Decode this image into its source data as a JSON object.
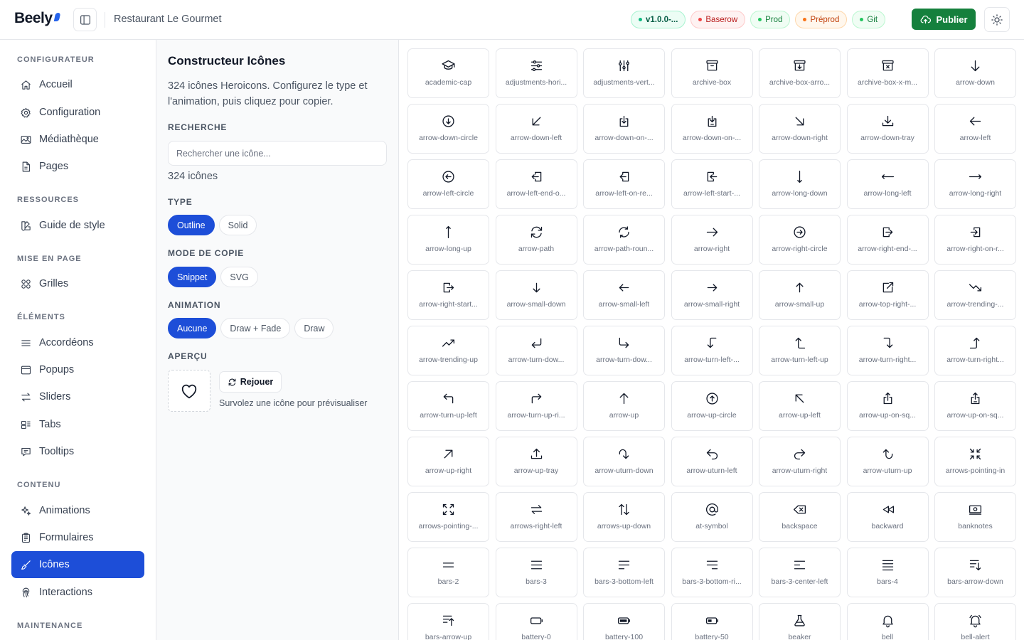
{
  "header": {
    "logo": "Beely",
    "site_name": "Restaurant Le Gourmet",
    "pills": [
      {
        "label": "v1.0.0-...",
        "kind": "version"
      },
      {
        "label": "Baserow",
        "kind": "baserow"
      },
      {
        "label": "Prod",
        "kind": "prod"
      },
      {
        "label": "Préprod",
        "kind": "preprod"
      },
      {
        "label": "Git",
        "kind": "git"
      }
    ],
    "publish_label": "Publier",
    "colors": {
      "accent": "#1d4ed8",
      "publish": "#15803d"
    }
  },
  "sidebar": {
    "sections": [
      {
        "title": "CONFIGURATEUR",
        "items": [
          {
            "label": "Accueil",
            "icon": "home-icon"
          },
          {
            "label": "Configuration",
            "icon": "cog-icon"
          },
          {
            "label": "Médiathèque",
            "icon": "photo-icon"
          },
          {
            "label": "Pages",
            "icon": "document-icon"
          }
        ]
      },
      {
        "title": "RESSOURCES",
        "items": [
          {
            "label": "Guide de style",
            "icon": "swatch-icon"
          }
        ]
      },
      {
        "title": "MISE EN PAGE",
        "items": [
          {
            "label": "Grilles",
            "icon": "squares-icon"
          }
        ]
      },
      {
        "title": "ÉLÉMENTS",
        "items": [
          {
            "label": "Accordéons",
            "icon": "bars-icon"
          },
          {
            "label": "Popups",
            "icon": "window-icon"
          },
          {
            "label": "Sliders",
            "icon": "arrows-right-left-icon"
          },
          {
            "label": "Tabs",
            "icon": "tabs-icon"
          },
          {
            "label": "Tooltips",
            "icon": "chat-icon"
          }
        ]
      },
      {
        "title": "CONTENU",
        "items": [
          {
            "label": "Animations",
            "icon": "sparkles-icon"
          },
          {
            "label": "Formulaires",
            "icon": "clipboard-icon"
          },
          {
            "label": "Icônes",
            "icon": "paint-brush-icon",
            "active": true
          },
          {
            "label": "Interactions",
            "icon": "finger-print-icon"
          }
        ]
      },
      {
        "title": "MAINTENANCE",
        "items": []
      }
    ]
  },
  "config": {
    "title": "Constructeur Icônes",
    "description": "324 icônes Heroicons. Configurez le type et l'animation, puis cliquez pour copier.",
    "search_label": "RECHERCHE",
    "search_placeholder": "Rechercher une icône...",
    "count": "324 icônes",
    "type_label": "TYPE",
    "type_options": [
      "Outline",
      "Solid"
    ],
    "type_selected": "Outline",
    "copy_label": "MODE DE COPIE",
    "copy_options": [
      "Snippet",
      "SVG"
    ],
    "copy_selected": "Snippet",
    "animation_label": "ANIMATION",
    "animation_options": [
      "Aucune",
      "Draw + Fade",
      "Draw"
    ],
    "animation_selected": "Aucune",
    "preview_label": "APERÇU",
    "preview_icon": "heart-icon",
    "replay_label": "Rejouer",
    "preview_hint": "Survolez une icône pour prévisualiser"
  },
  "icons": [
    "academic-cap",
    "adjustments-hori...",
    "adjustments-vert...",
    "archive-box",
    "archive-box-arro...",
    "archive-box-x-m...",
    "arrow-down",
    "arrow-down-circle",
    "arrow-down-left",
    "arrow-down-on-...",
    "arrow-down-on-...",
    "arrow-down-right",
    "arrow-down-tray",
    "arrow-left",
    "arrow-left-circle",
    "arrow-left-end-o...",
    "arrow-left-on-re...",
    "arrow-left-start-...",
    "arrow-long-down",
    "arrow-long-left",
    "arrow-long-right",
    "arrow-long-up",
    "arrow-path",
    "arrow-path-roun...",
    "arrow-right",
    "arrow-right-circle",
    "arrow-right-end-...",
    "arrow-right-on-r...",
    "arrow-right-start...",
    "arrow-small-down",
    "arrow-small-left",
    "arrow-small-right",
    "arrow-small-up",
    "arrow-top-right-...",
    "arrow-trending-...",
    "arrow-trending-up",
    "arrow-turn-dow...",
    "arrow-turn-dow...",
    "arrow-turn-left-...",
    "arrow-turn-left-up",
    "arrow-turn-right...",
    "arrow-turn-right...",
    "arrow-turn-up-left",
    "arrow-turn-up-ri...",
    "arrow-up",
    "arrow-up-circle",
    "arrow-up-left",
    "arrow-up-on-sq...",
    "arrow-up-on-sq...",
    "arrow-up-right",
    "arrow-up-tray",
    "arrow-uturn-down",
    "arrow-uturn-left",
    "arrow-uturn-right",
    "arrow-uturn-up",
    "arrows-pointing-in",
    "arrows-pointing-...",
    "arrows-right-left",
    "arrows-up-down",
    "at-symbol",
    "backspace",
    "backward",
    "banknotes",
    "bars-2",
    "bars-3",
    "bars-3-bottom-left",
    "bars-3-bottom-ri...",
    "bars-3-center-left",
    "bars-4",
    "bars-arrow-down",
    "bars-arrow-up",
    "battery-0",
    "battery-100",
    "battery-50",
    "beaker",
    "bell",
    "bell-alert"
  ]
}
